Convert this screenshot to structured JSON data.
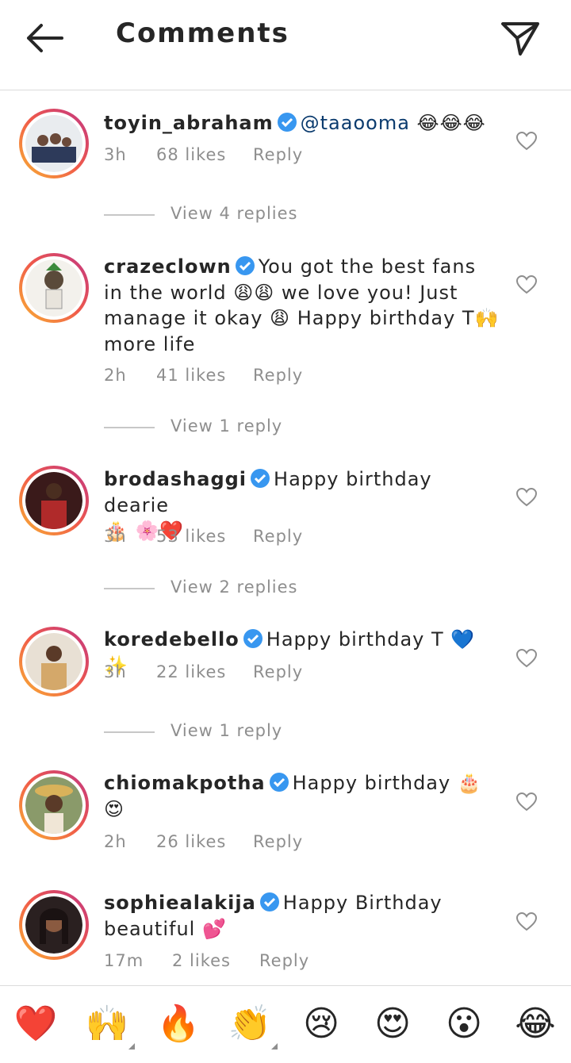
{
  "header": {
    "title": "Comments"
  },
  "comments": [
    {
      "username": "toyin_abraham",
      "mention": "@taaooma",
      "text": "",
      "emoji": "😂😂😂",
      "time": "3h",
      "likes": "68 likes",
      "reply": "Reply",
      "view_replies": "View 4 replies"
    },
    {
      "username": "crazeclown",
      "line1": "You got the best fans",
      "line2": "in the world 😩😩 we love you! Just",
      "line3": "manage  it okay 😩 Happy birthday T🙌",
      "line4": "more life",
      "time": "2h",
      "likes": "41 likes",
      "reply": "Reply",
      "view_replies": "View 1 reply"
    },
    {
      "username": "brodashaggi",
      "line1": "Happy birthday dearie",
      "line2": "🎂 🌸❤️",
      "time": "3h",
      "likes": "53 likes",
      "reply": "Reply",
      "view_replies": "View 2 replies"
    },
    {
      "username": "koredebello",
      "line1": "Happy birthday T 💙 ✨",
      "time": "3h",
      "likes": "22 likes",
      "reply": "Reply",
      "view_replies": "View 1 reply"
    },
    {
      "username": "chiomakpotha",
      "line1": "Happy birthday 🎂",
      "line2": "😍",
      "time": "2h",
      "likes": "26 likes",
      "reply": "Reply"
    },
    {
      "username": "sophiealakija",
      "line1": "Happy Birthday",
      "line2": "beautiful 💕",
      "time": "17m",
      "likes": "2 likes",
      "reply": "Reply"
    }
  ],
  "emoji_bar": [
    "❤️",
    "🙌",
    "🔥",
    "👏",
    "😢",
    "😍",
    "😮",
    "😂"
  ],
  "colors": {
    "verified": "#3897f0",
    "ring_start": "#f9b233",
    "ring_end": "#c13584",
    "meta": "#8e8e8e"
  }
}
